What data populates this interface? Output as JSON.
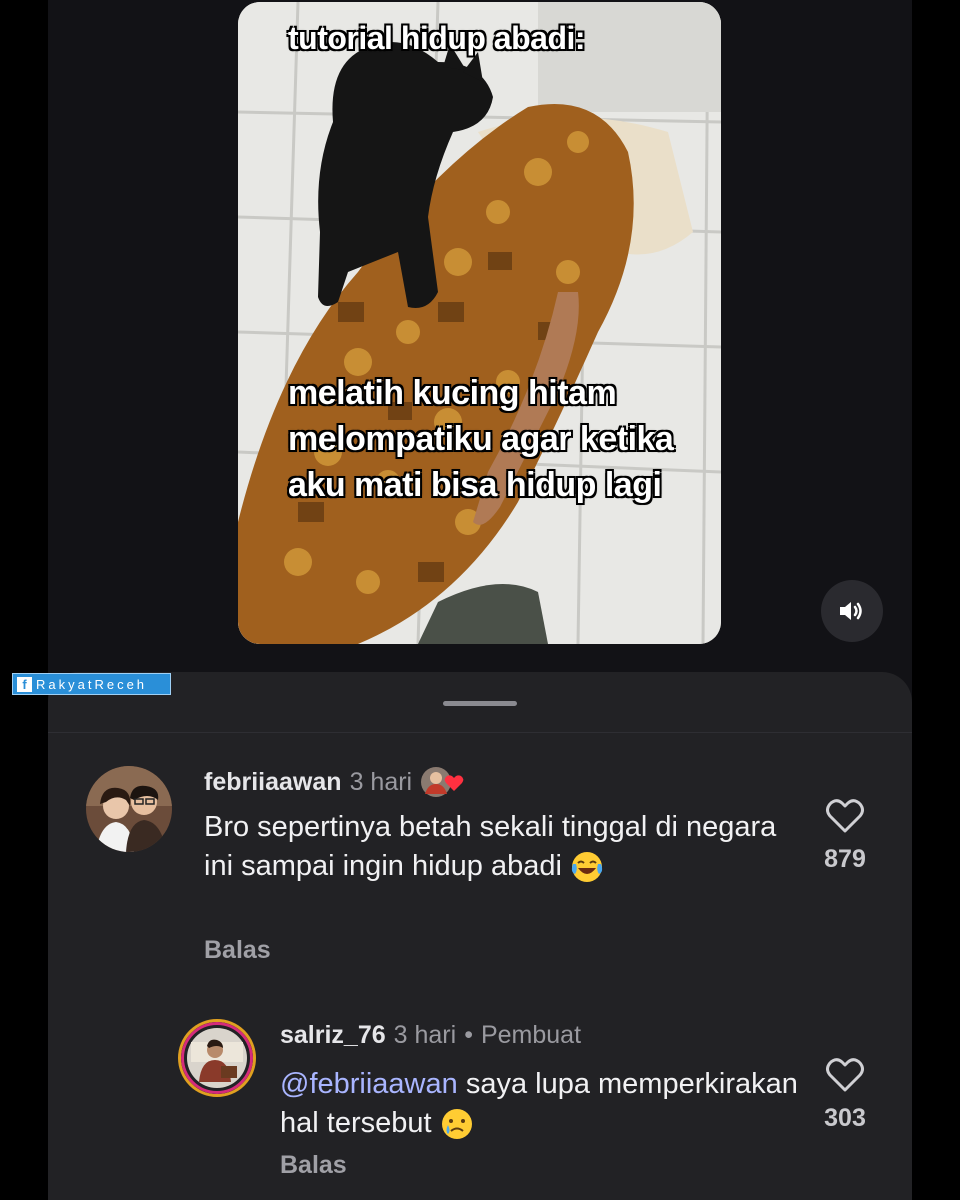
{
  "video": {
    "caption_top": "tutorial hidup abadi:",
    "caption_main": "melatih kucing hitam\nmelompatiku agar ketika\naku mati bisa hidup lagi"
  },
  "watermark": {
    "text": "RakyatReceh",
    "icon": "facebook-icon"
  },
  "comments": [
    {
      "username": "febriiaawan",
      "time": "3 hari",
      "liked_by_creator": true,
      "body": "Bro sepertinya betah sekali tinggal di negara ini sampai ingin hidup abadi",
      "emoji": "laughing-tears-emoji",
      "reply_label": "Balas",
      "likes": "879"
    },
    {
      "username": "salriz_76",
      "time": "3 hari",
      "separator": "•",
      "creator_label": "Pembuat",
      "mention": "@febriiaawan",
      "body": " saya lupa memperkirakan hal tersebut",
      "emoji": "sad-tear-emoji",
      "reply_label": "Balas",
      "likes": "303"
    }
  ],
  "colors": {
    "background": "#121216",
    "sheet": "#222225",
    "mention": "#a9b5ff",
    "heart_red": "#ff3040",
    "watermark_blue": "#2a8fd8"
  }
}
